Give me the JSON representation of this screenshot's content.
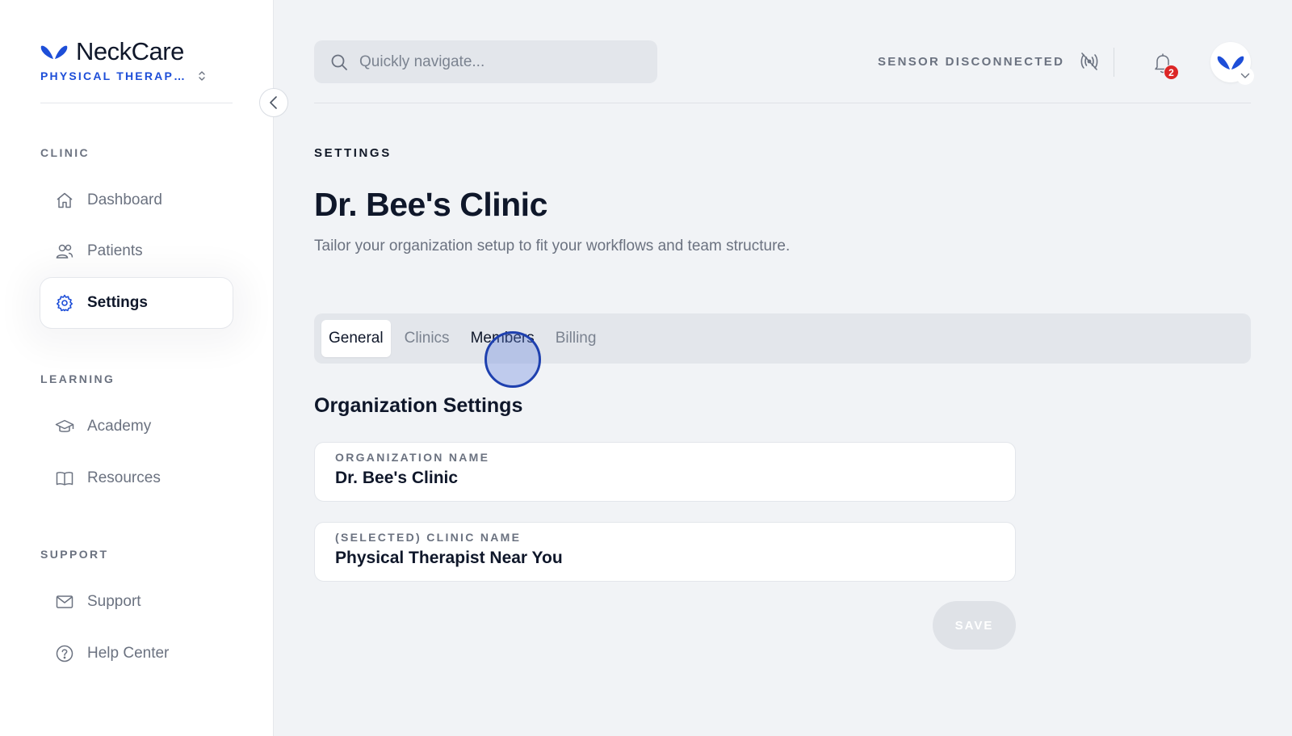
{
  "app": {
    "brand_name": "NeckCare",
    "org_selector": "PHYSICAL THERAPIST NEAR YOU",
    "brand_color": "#1d4ed8"
  },
  "sidebar": {
    "sections": [
      {
        "label": "CLINIC",
        "items": [
          {
            "label": "Dashboard",
            "icon": "home-icon",
            "active": false
          },
          {
            "label": "Patients",
            "icon": "users-icon",
            "active": false
          },
          {
            "label": "Settings",
            "icon": "gear-icon",
            "active": true
          }
        ]
      },
      {
        "label": "LEARNING",
        "items": [
          {
            "label": "Academy",
            "icon": "graduation-cap-icon",
            "active": false
          },
          {
            "label": "Resources",
            "icon": "book-icon",
            "active": false
          }
        ]
      },
      {
        "label": "SUPPORT",
        "items": [
          {
            "label": "Support",
            "icon": "mail-icon",
            "active": false
          },
          {
            "label": "Help Center",
            "icon": "help-circle-icon",
            "active": false
          }
        ]
      }
    ]
  },
  "header": {
    "search_placeholder": "Quickly navigate...",
    "sensor_status": "SENSOR DISCONNECTED",
    "notification_count": "2"
  },
  "page": {
    "kicker": "SETTINGS",
    "title": "Dr. Bee's Clinic",
    "description": "Tailor your organization setup to fit your workflows and team structure.",
    "tabs": [
      {
        "label": "General",
        "active": true
      },
      {
        "label": "Clinics",
        "active": false
      },
      {
        "label": "Members",
        "active": false
      },
      {
        "label": "Billing",
        "active": false
      }
    ],
    "section_title": "Organization Settings",
    "fields": [
      {
        "label": "ORGANIZATION NAME",
        "value": "Dr. Bee's Clinic"
      },
      {
        "label": "(SELECTED) CLINIC NAME",
        "value": "Physical Therapist Near You"
      }
    ],
    "save_label": "SAVE"
  }
}
